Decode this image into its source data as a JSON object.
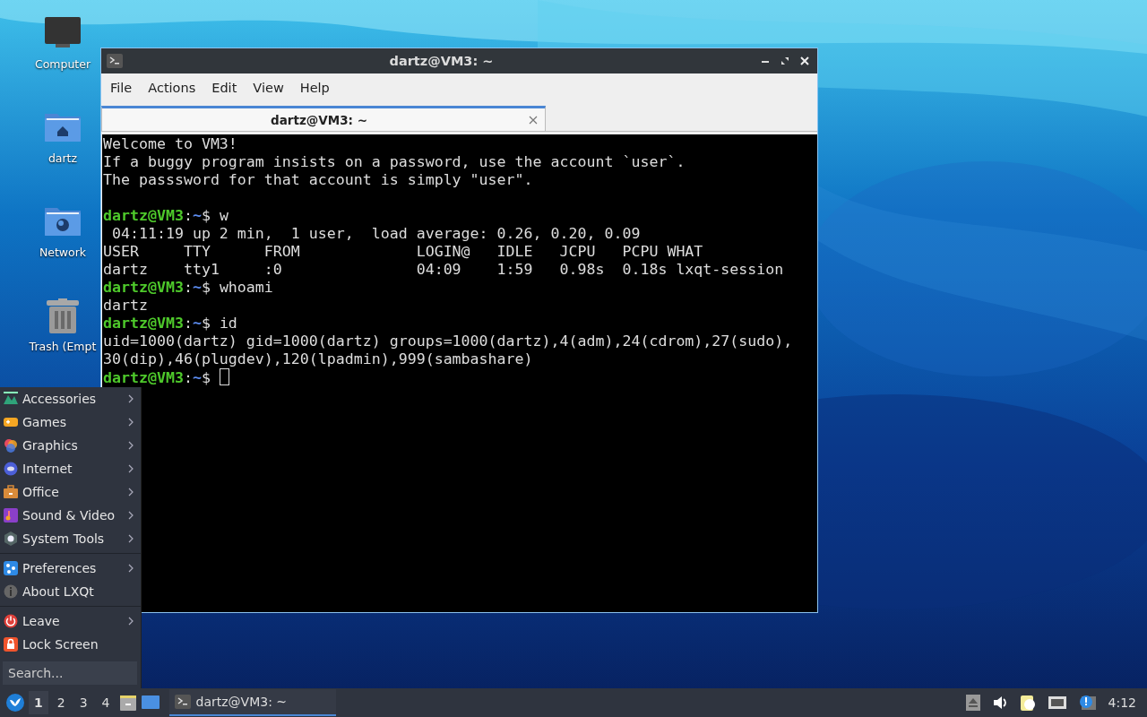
{
  "desktop_icons": [
    {
      "kind": "computer",
      "label": "Computer"
    },
    {
      "kind": "home",
      "label": "dartz"
    },
    {
      "kind": "network",
      "label": "Network"
    },
    {
      "kind": "trash",
      "label": "Trash (Empt"
    }
  ],
  "window": {
    "title": "dartz@VM3: ~",
    "menu": [
      "File",
      "Actions",
      "Edit",
      "View",
      "Help"
    ],
    "tabs": [
      {
        "label": "dartz@VM3: ~",
        "selected": true
      }
    ],
    "terminal": [
      {
        "kind": "output",
        "text": "Welcome to VM3!"
      },
      {
        "kind": "output",
        "text": "If a buggy program insists on a password, use the account `user`."
      },
      {
        "kind": "output",
        "text": "The passsword for that account is simply \"user\"."
      },
      {
        "kind": "blank"
      },
      {
        "kind": "prompt",
        "host": "dartz@VM3",
        "colon": ":",
        "path": "~",
        "dollar": "$",
        "command": "w"
      },
      {
        "kind": "output",
        "text": " 04:11:19 up 2 min,  1 user,  load average: 0.26, 0.20, 0.09"
      },
      {
        "kind": "output",
        "text": "USER     TTY      FROM             LOGIN@   IDLE   JCPU   PCPU WHAT"
      },
      {
        "kind": "output",
        "text": "dartz    tty1     :0               04:09    1:59   0.98s  0.18s lxqt-session"
      },
      {
        "kind": "prompt",
        "host": "dartz@VM3",
        "colon": ":",
        "path": "~",
        "dollar": "$",
        "command": "whoami"
      },
      {
        "kind": "output",
        "text": "dartz"
      },
      {
        "kind": "prompt",
        "host": "dartz@VM3",
        "colon": ":",
        "path": "~",
        "dollar": "$",
        "command": "id"
      },
      {
        "kind": "output",
        "text": "uid=1000(dartz) gid=1000(dartz) groups=1000(dartz),4(adm),24(cdrom),27(sudo),"
      },
      {
        "kind": "output",
        "text": "30(dip),46(plugdev),120(lpadmin),999(sambashare)"
      },
      {
        "kind": "prompt",
        "host": "dartz@VM3",
        "colon": ":",
        "path": "~",
        "dollar": "$",
        "cursor": true
      }
    ]
  },
  "start_menu": {
    "groups": [
      [
        {
          "label": "Accessories",
          "submenu": true
        },
        {
          "label": "Games",
          "submenu": true
        },
        {
          "label": "Graphics",
          "submenu": true
        },
        {
          "label": "Internet",
          "submenu": true
        },
        {
          "label": "Office",
          "submenu": true
        },
        {
          "label": "Sound & Video",
          "submenu": true
        },
        {
          "label": "System Tools",
          "submenu": true
        }
      ],
      [
        {
          "label": "Preferences",
          "submenu": true
        },
        {
          "label": "About LXQt",
          "submenu": false
        }
      ],
      [
        {
          "label": "Leave",
          "submenu": true
        },
        {
          "label": "Lock Screen",
          "submenu": false
        }
      ]
    ],
    "search": {
      "placeholder": "Search..."
    }
  },
  "taskbar": {
    "desktops": [
      {
        "label": "1",
        "selected": true
      },
      {
        "label": "2",
        "selected": false
      },
      {
        "label": "3",
        "selected": false
      },
      {
        "label": "4",
        "selected": false
      }
    ],
    "tasks": [
      {
        "label": "dartz@VM3: ~",
        "selected": true
      }
    ],
    "clock": "4:12"
  }
}
